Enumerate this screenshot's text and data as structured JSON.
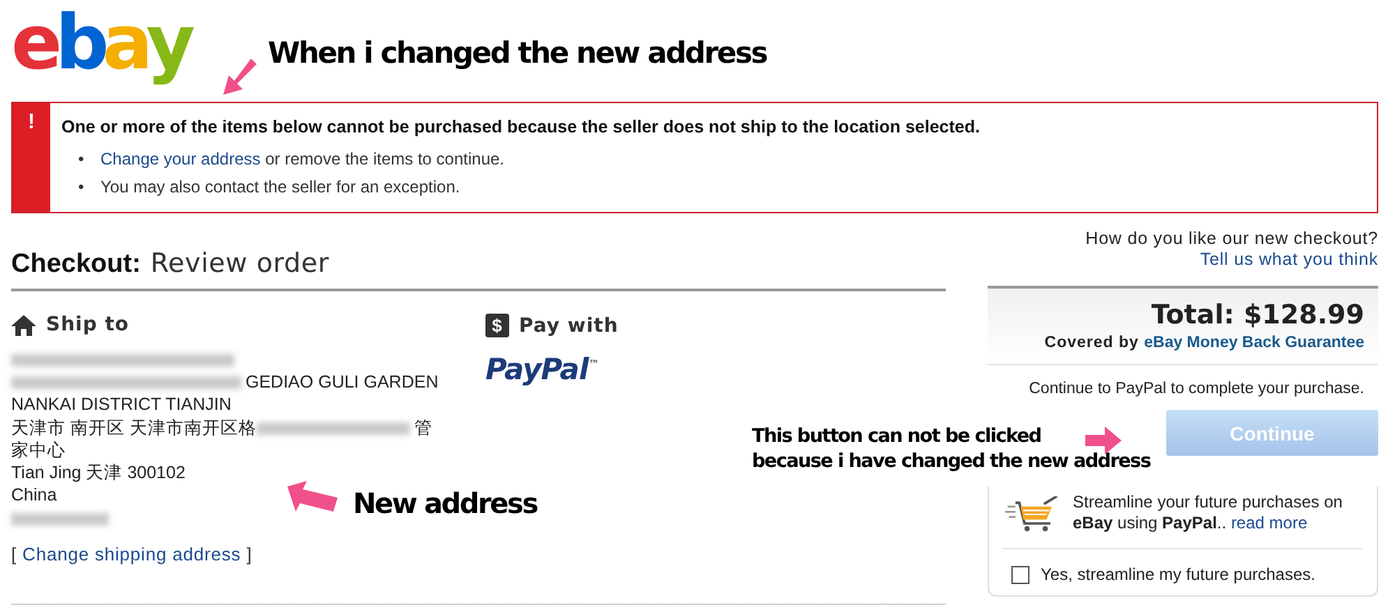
{
  "logo": {
    "letters": [
      {
        "char": "e",
        "color": "#e53238"
      },
      {
        "char": "b",
        "color": "#0064d2"
      },
      {
        "char": "a",
        "color": "#f5af02"
      },
      {
        "char": "y",
        "color": "#86b817"
      }
    ]
  },
  "annotations": [
    {
      "kind": "title",
      "lines": [
        "When i changed the new address"
      ]
    },
    {
      "kind": "address",
      "lines": [
        "New address"
      ]
    },
    {
      "kind": "button",
      "lines": [
        "This button can not be clicked",
        "because i have changed the new address"
      ]
    }
  ],
  "alert": {
    "icon": "!",
    "title": "One or more of the items below cannot be purchased because the seller does not ship to the location selected.",
    "items": [
      {
        "bullet": "•",
        "link": "Change your address",
        "text": "or remove the items to continue."
      },
      {
        "bullet": "•",
        "text": "You may also contact the seller for an exception."
      }
    ]
  },
  "feedback": {
    "question": "How do you like our new checkout?",
    "link": "Tell us what you think"
  },
  "heading": {
    "label": "Checkout:",
    "title": "Review order"
  },
  "ship_to": {
    "label": "Ship to",
    "lines": [
      [
        {
          "kind": "blurred"
        }
      ],
      [
        {
          "kind": "blurred"
        },
        {
          "kind": "text",
          "text": "GEDIAO GULI GARDEN"
        }
      ],
      [
        {
          "kind": "text",
          "text": "NANKAI DISTRICT TIANJIN"
        }
      ],
      [
        {
          "kind": "text",
          "text": "天津市 南开区 天津市南开区格"
        },
        {
          "kind": "blurred"
        },
        {
          "kind": "text",
          "text": "管"
        }
      ],
      [
        {
          "kind": "text",
          "text": "家中心"
        }
      ],
      [
        {
          "kind": "text",
          "text": "Tian Jing 天津 300102"
        }
      ],
      [
        {
          "kind": "text",
          "text": "China"
        }
      ],
      [
        {
          "kind": "blurred"
        }
      ]
    ],
    "open_bracket": "[",
    "link": "Change shipping address",
    "close_bracket": "]"
  },
  "pay_with": {
    "label": "Pay with",
    "icon": "$",
    "logo": "PayPal",
    "logo_mark": "™"
  },
  "summary": {
    "total_label": "Total:",
    "total": "$128.99",
    "covered_by": "Covered by",
    "guarantee": "eBay Money Back Guarantee",
    "note": "Continue to PayPal to complete your purchase.",
    "button": {
      "label": "Continue",
      "disabled": true
    },
    "streamline": {
      "text": "Streamline your future purchases on **eBay** using **PayPal**..",
      "link": "read more"
    },
    "checkbox": {
      "label": "Yes, streamline my future purchases.",
      "checked": false
    }
  }
}
